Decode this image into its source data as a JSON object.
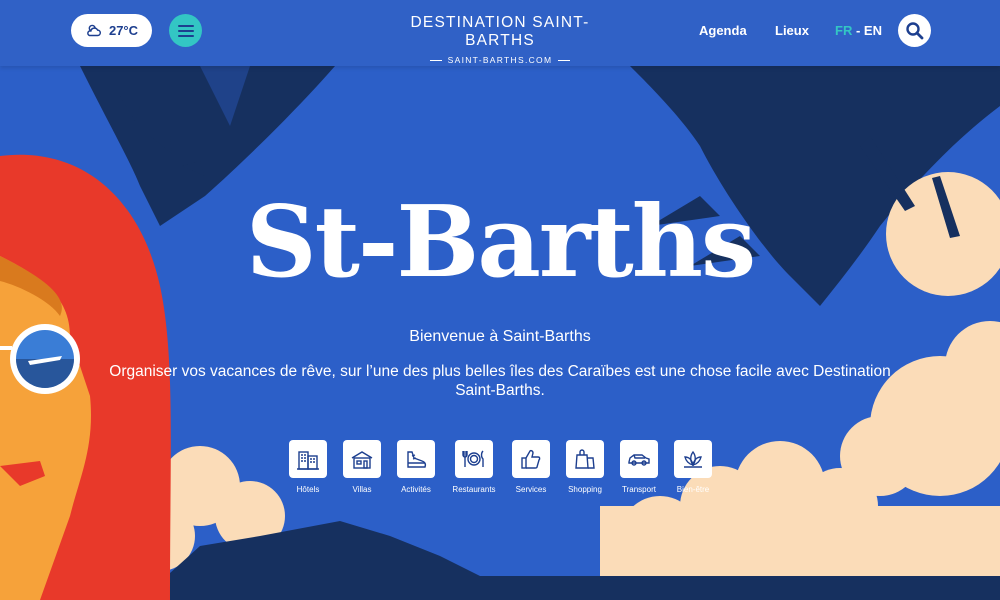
{
  "header": {
    "temperature": "27°C",
    "brand_title": "DESTINATION SAINT-BARTHS",
    "brand_site": "SAINT-BARTHS.COM",
    "nav": {
      "agenda": "Agenda",
      "lieux": "Lieux"
    },
    "lang": {
      "fr": "FR",
      "sep": " - ",
      "en": "EN"
    }
  },
  "hero": {
    "title": "St-Barths",
    "welcome": "Bienvenue à Saint-Barths",
    "description": "Organiser vos vacances de rêve, sur l’une des plus belles îles des Caraïbes est une chose facile avec Destination Saint-Barths."
  },
  "categories": [
    {
      "label": "Hôtels",
      "icon": "hotel-icon"
    },
    {
      "label": "Villas",
      "icon": "villa-icon"
    },
    {
      "label": "Activités",
      "icon": "sneaker-icon"
    },
    {
      "label": "Restaurants",
      "icon": "plate-cutlery-icon"
    },
    {
      "label": "Services",
      "icon": "thumbs-up-icon"
    },
    {
      "label": "Shopping",
      "icon": "shopping-bag-icon"
    },
    {
      "label": "Transport",
      "icon": "car-icon"
    },
    {
      "label": "Bien-être",
      "icon": "lotus-icon"
    }
  ],
  "colors": {
    "primary_blue": "#2c5fc8",
    "navy": "#1d3f8f",
    "teal": "#33c6c4",
    "sun_cream": "#fbdcb8",
    "hair_red": "#e8392a",
    "skin_orange": "#f6a23a"
  }
}
